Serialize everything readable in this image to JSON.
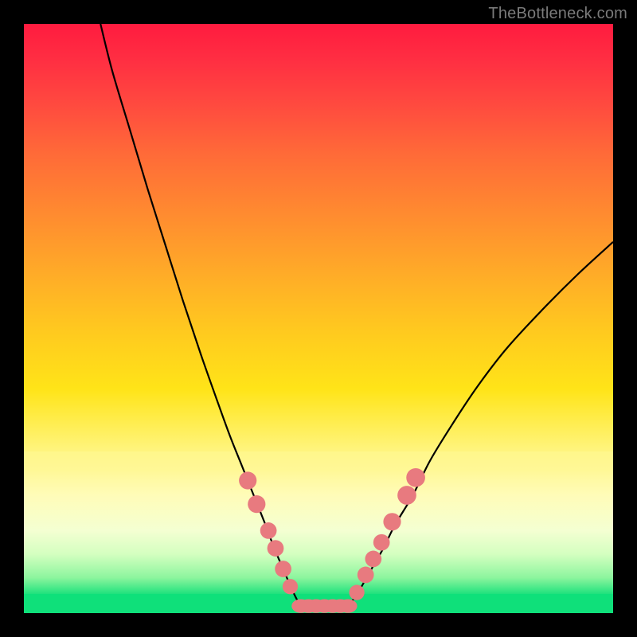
{
  "watermark": "TheBottleneck.com",
  "colors": {
    "marker": "#e87a7f",
    "curve": "#000000",
    "gradient_top": "#ff1b3f",
    "gradient_bottom": "#0cd66f"
  },
  "chart_data": {
    "type": "line",
    "title": "",
    "xlabel": "",
    "ylabel": "",
    "xlim": [
      0,
      100
    ],
    "ylim": [
      0,
      100
    ],
    "curves": [
      {
        "name": "left",
        "x": [
          13,
          15,
          18,
          21,
          24,
          27,
          30,
          33,
          35,
          37,
          39,
          41,
          42.5,
          44,
          45.5,
          47
        ],
        "y": [
          100,
          92,
          82,
          72,
          62.5,
          53,
          44,
          35.5,
          30,
          25,
          20,
          15,
          11,
          7.5,
          4,
          1
        ]
      },
      {
        "name": "right",
        "x": [
          55,
          57,
          59,
          61,
          63,
          66,
          69,
          73,
          77,
          82,
          88,
          94,
          100
        ],
        "y": [
          1,
          4,
          7.5,
          11,
          15,
          20,
          26,
          32.5,
          38.5,
          45,
          51.5,
          57.5,
          63
        ]
      }
    ],
    "flat_segment": {
      "x": [
        47,
        55
      ],
      "y": 1
    },
    "markers_left": [
      {
        "x": 38.0,
        "y": 22.5,
        "r": 1.5
      },
      {
        "x": 39.5,
        "y": 18.5,
        "r": 1.5
      },
      {
        "x": 41.5,
        "y": 14.0,
        "r": 1.4
      },
      {
        "x": 42.7,
        "y": 11.0,
        "r": 1.4
      },
      {
        "x": 44.0,
        "y": 7.5,
        "r": 1.4
      },
      {
        "x": 45.2,
        "y": 4.5,
        "r": 1.3
      }
    ],
    "markers_right": [
      {
        "x": 56.5,
        "y": 3.5,
        "r": 1.3
      },
      {
        "x": 58.0,
        "y": 6.5,
        "r": 1.4
      },
      {
        "x": 59.3,
        "y": 9.2,
        "r": 1.4
      },
      {
        "x": 60.7,
        "y": 12.0,
        "r": 1.4
      },
      {
        "x": 62.5,
        "y": 15.5,
        "r": 1.5
      },
      {
        "x": 65.0,
        "y": 20.0,
        "r": 1.6
      },
      {
        "x": 66.5,
        "y": 23.0,
        "r": 1.6
      }
    ],
    "markers_bottom": [
      {
        "x": 47.0,
        "y": 1.2,
        "r": 1.3
      },
      {
        "x": 48.3,
        "y": 1.2,
        "r": 1.3
      },
      {
        "x": 49.6,
        "y": 1.2,
        "r": 1.3
      },
      {
        "x": 51.0,
        "y": 1.2,
        "r": 1.3
      },
      {
        "x": 52.4,
        "y": 1.2,
        "r": 1.3
      },
      {
        "x": 53.7,
        "y": 1.2,
        "r": 1.3
      },
      {
        "x": 55.0,
        "y": 1.2,
        "r": 1.3
      }
    ]
  }
}
